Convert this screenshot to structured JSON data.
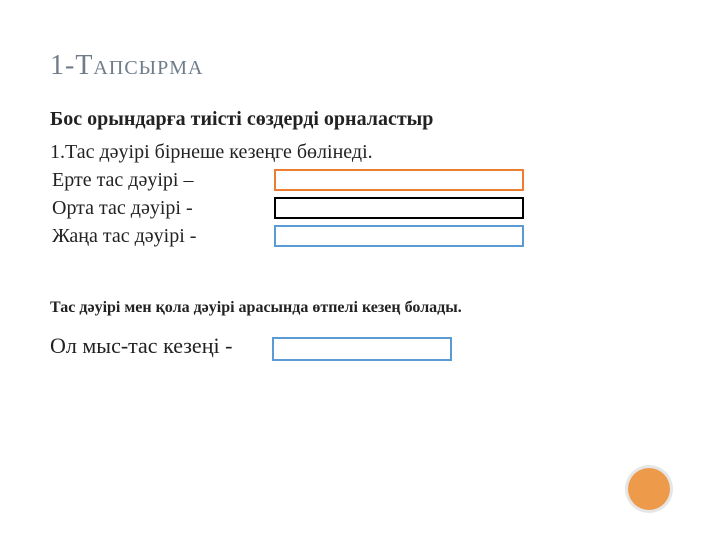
{
  "title": "1-Тапсырма",
  "instruction": "Бос орындарға тиісті сөздерді орналастыр",
  "lead": "1.Тас дәуірі бірнеше кезеңге бөлінеді.",
  "rows": [
    {
      "label": "Ерте тас дәуірі  –",
      "blank_color": "orange"
    },
    {
      "label": "Орта тас дәуірі  -",
      "blank_color": "black"
    },
    {
      "label": "Жаңа тас дәуірі  -",
      "blank_color": "blue"
    }
  ],
  "note": "Тас дәуірі мен қола дәуірі арасында өтпелі кезең болады.",
  "copper": {
    "label": "Ол мыс-тас кезеңі  -",
    "blank_color": "blue"
  },
  "accent_color": "#ed9a4a"
}
